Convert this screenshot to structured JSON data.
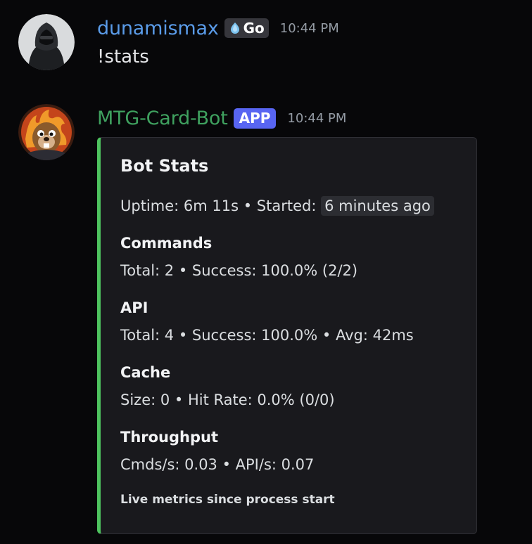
{
  "message1": {
    "username": "dunamismax",
    "tag": "Go",
    "time": "10:44 PM",
    "content": "!stats"
  },
  "message2": {
    "username": "MTG-Card-Bot",
    "tag": "APP",
    "time": "10:44 PM",
    "embed": {
      "title": "Bot Stats",
      "uptime_prefix": "Uptime: 6m 11s • Started:",
      "started_relative": "6 minutes ago",
      "fields": [
        {
          "name": "Commands",
          "value": "Total: 2 • Success: 100.0% (2/2)"
        },
        {
          "name": "API",
          "value": "Total: 4 • Success: 100.0% • Avg: 42ms"
        },
        {
          "name": "Cache",
          "value": "Size: 0 • Hit Rate: 0.0% (0/0)"
        },
        {
          "name": "Throughput",
          "value": "Cmds/s: 0.03 • API/s: 0.07"
        }
      ],
      "footer": "Live metrics since process start",
      "accent_color": "#4ec35f"
    }
  },
  "colors": {
    "background": "#070709",
    "user1": "#5a9be8",
    "user2": "#3fa15f",
    "app_badge": "#5865f2"
  },
  "icons": {
    "avatar1": "hooded-figure-avatar",
    "avatar2": "bot-creature-avatar",
    "tag1": "crystal-drop-icon"
  }
}
